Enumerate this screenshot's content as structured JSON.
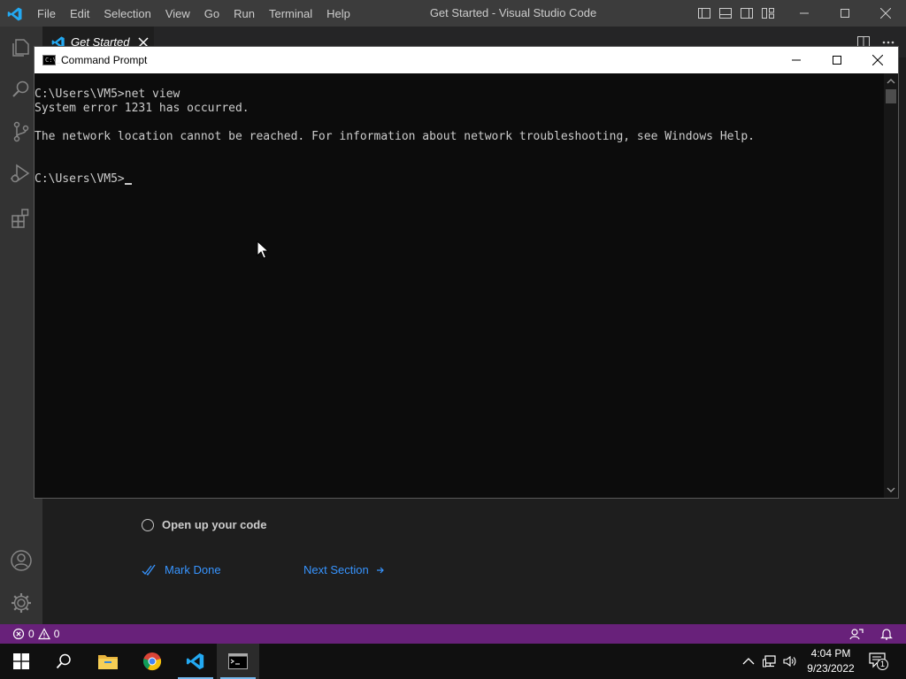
{
  "window_title": "Get Started - Visual Studio Code",
  "menu": [
    "File",
    "Edit",
    "Selection",
    "View",
    "Go",
    "Run",
    "Terminal",
    "Help"
  ],
  "tab": {
    "label": "Get Started"
  },
  "walkthrough": {
    "step_label": "Open up your code",
    "mark_done": "Mark Done",
    "next_section": "Next Section"
  },
  "status": {
    "errors": "0",
    "warnings": "0"
  },
  "cmd": {
    "title": "Command Prompt",
    "icon_text": "C:\\_",
    "lines": [
      "C:\\Users\\VM5>net view",
      "System error 1231 has occurred.",
      "",
      "The network location cannot be reached. For information about network troubleshooting, see Windows Help.",
      "",
      "",
      "C:\\Users\\VM5>"
    ]
  },
  "clock": {
    "time": "4:04 PM",
    "date": "9/23/2022"
  },
  "notifications_count": "1",
  "colors": {
    "statusbar": "#68217a",
    "vscode_blue": "#3794ff",
    "titlebar": "#3c3c3c",
    "activitybar": "#333333",
    "console_bg": "#0c0c0c",
    "taskbar": "#101010"
  },
  "icons": {
    "activity": [
      "explorer-icon",
      "search-icon",
      "source-control-icon",
      "run-debug-icon",
      "extensions-icon",
      "accounts-icon",
      "manage-gear-icon"
    ],
    "taskbar": [
      "windows-start-icon",
      "search-icon",
      "file-explorer-icon",
      "chrome-icon",
      "vscode-icon",
      "command-prompt-icon"
    ],
    "tray": [
      "chevron-up-icon",
      "network-icon",
      "volume-icon",
      "notification-icon"
    ]
  }
}
